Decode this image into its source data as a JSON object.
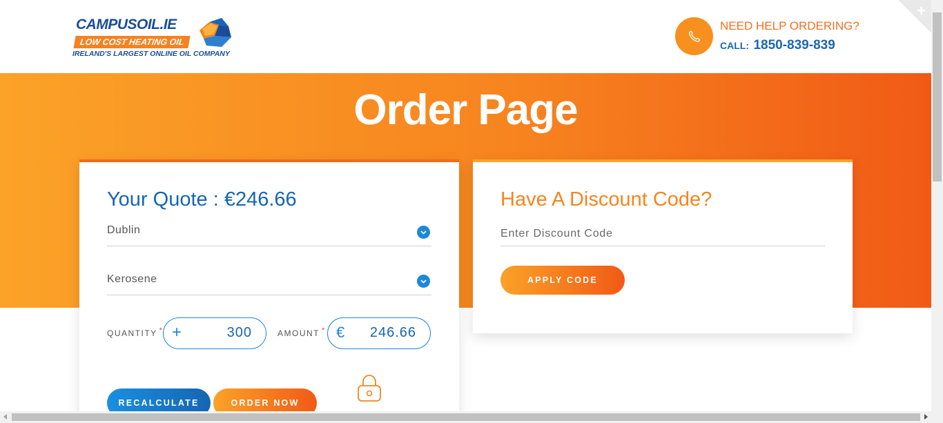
{
  "header": {
    "logo": {
      "brand_prefix": "CAMPUS",
      "brand_suffix": "OIL.IE",
      "tagline": "LOW COST HEATING OIL",
      "subtitle": "IRELAND'S LARGEST ONLINE OIL COMPANY"
    },
    "help": {
      "title": "NEED HELP ORDERING?",
      "call_label": "CALL:",
      "phone": "1850-839-839"
    }
  },
  "hero": {
    "title": "Order Page"
  },
  "quote": {
    "title": "Your Quote : €246.66",
    "county": "Dublin",
    "fuel_type": "Kerosene",
    "quantity_label": "QUANTITY",
    "quantity_value": "300",
    "amount_label": "AMOUNT",
    "amount_value": "246.66",
    "currency_symbol": "€",
    "required_mark": "*",
    "recalculate_label": "RECALCULATE",
    "order_label": "ORDER NOW"
  },
  "discount": {
    "title": "Have A Discount Code?",
    "placeholder": "Enter Discount Code",
    "apply_label": "APPLY CODE"
  },
  "colors": {
    "brand_blue": "#1565b2",
    "accent_orange": "#f7841f",
    "hero_start": "#fba228",
    "hero_end": "#f15a16"
  }
}
